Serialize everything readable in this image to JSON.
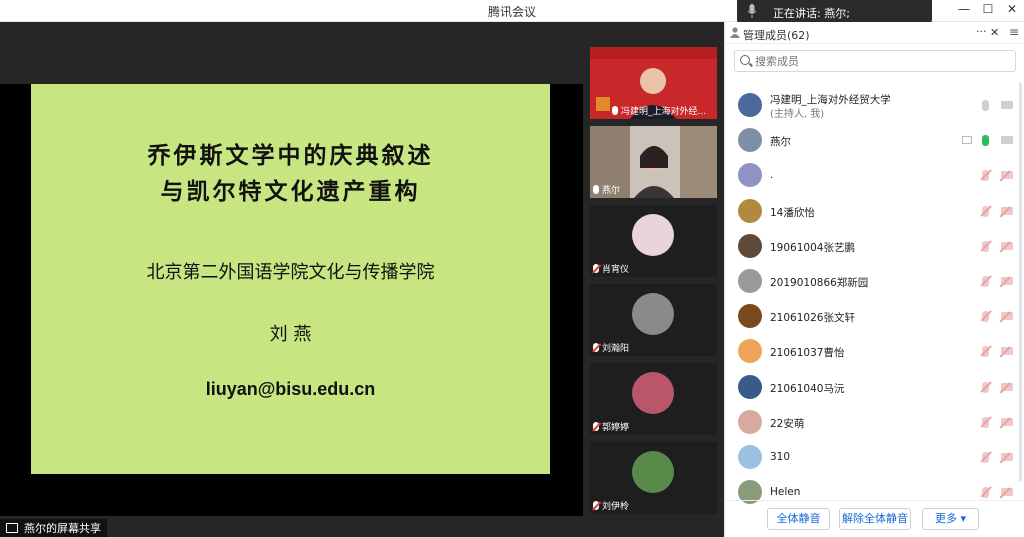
{
  "window": {
    "title": "腾讯会议"
  },
  "speaking": {
    "label": "正在讲话: 燕尔;"
  },
  "window_controls": {
    "minimize": "—",
    "maximize": "☐",
    "close": "✕"
  },
  "slide": {
    "title_line1": "乔伊斯文学中的庆典叙述",
    "title_line2": "与凯尔特文化遗产重构",
    "institution": "北京第二外国语学院文化与传播学院",
    "author": "刘 燕",
    "email": "liuyan@bisu.edu.cn",
    "background_color": "#c7e681"
  },
  "share_label": "燕尔的屏幕共享",
  "video_tiles": [
    {
      "name": "冯建明_上海对外经...",
      "type": "camera-red",
      "muted": false
    },
    {
      "name": "燕尔",
      "type": "camera-room",
      "muted": false,
      "active": true
    },
    {
      "name": "肖宵仪",
      "type": "avatar",
      "muted": true,
      "avatar_color": "#e9d4da"
    },
    {
      "name": "刘瀚阳",
      "type": "avatar",
      "muted": true,
      "avatar_color": "#8a8a8a"
    },
    {
      "name": "郭婷婷",
      "type": "avatar",
      "muted": true,
      "avatar_color": "#b9566a"
    },
    {
      "name": "刘伊柃",
      "type": "avatar",
      "muted": true,
      "avatar_color": "#5a8a4a"
    }
  ],
  "members_panel": {
    "title": "管理成员(62)",
    "more": "···",
    "close": "✕",
    "menu": "≡",
    "search_placeholder": "搜索成员",
    "members": [
      {
        "name": "冯建明_上海对外经贸大学",
        "sub": "(主持人, 我)",
        "avatar_color": "#4b6a9b",
        "mic": "off-grey",
        "cam": "grey"
      },
      {
        "name": "燕尔",
        "sub": "",
        "avatar_color": "#7c8fa6",
        "mic": "on",
        "cam": "grey",
        "screen": true
      },
      {
        "name": ".",
        "sub": "",
        "avatar_color": "#8f92c2",
        "mic": "muted",
        "cam": "muted"
      },
      {
        "name": "14潘欣怡",
        "sub": "",
        "avatar_color": "#b08a3e",
        "mic": "muted",
        "cam": "muted"
      },
      {
        "name": "19061004张艺鹏",
        "sub": "",
        "avatar_color": "#5d4a3a",
        "mic": "muted",
        "cam": "muted"
      },
      {
        "name": "2019010866郑新园",
        "sub": "",
        "avatar_color": "#9a9a9a",
        "mic": "muted",
        "cam": "muted"
      },
      {
        "name": "21061026张文轩",
        "sub": "",
        "avatar_color": "#7a4a1e",
        "mic": "muted",
        "cam": "muted"
      },
      {
        "name": "21061037曹怡",
        "sub": "",
        "avatar_color": "#f0a45a",
        "mic": "muted",
        "cam": "muted"
      },
      {
        "name": "21061040马沅",
        "sub": "",
        "avatar_color": "#3a5a8a",
        "mic": "muted",
        "cam": "muted"
      },
      {
        "name": "22安萌",
        "sub": "",
        "avatar_color": "#d9a8a0",
        "mic": "muted",
        "cam": "muted"
      },
      {
        "name": "310",
        "sub": "",
        "avatar_color": "#9cc0e0",
        "mic": "muted",
        "cam": "muted"
      },
      {
        "name": "Helen",
        "sub": "",
        "avatar_color": "#8a9a7a",
        "mic": "muted",
        "cam": "muted"
      }
    ],
    "footer": {
      "mute_all": "全体静音",
      "unmute_all": "解除全体静音",
      "more": "更多 ▾"
    }
  },
  "colors": {
    "accent": "#1769d6",
    "active_speaker": "#2fbd5b",
    "muted_red": "#e8a3a3"
  }
}
